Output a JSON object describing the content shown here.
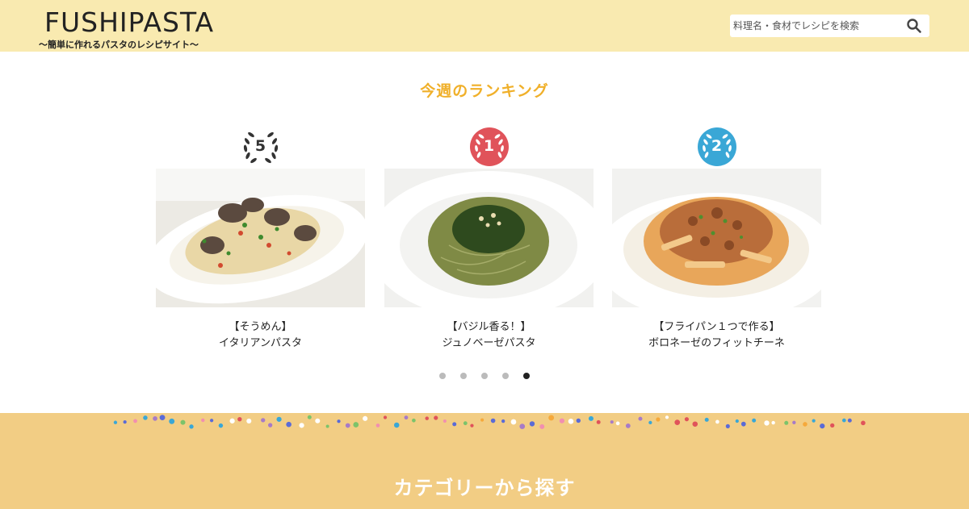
{
  "header": {
    "logo": "FUSHIPASTA",
    "tagline": "〜簡単に作れるパスタのレシピサイト〜",
    "search": {
      "placeholder": "料理名・食材でレシピを検索",
      "value": ""
    }
  },
  "ranking": {
    "title": "今週のランキング",
    "items": [
      {
        "rank": "5",
        "badge_color": "#ffffff",
        "line1": "【そうめん】",
        "line2": "イタリアンパスタ"
      },
      {
        "rank": "1",
        "badge_color": "#e0535a",
        "line1": "【バジル香る！】",
        "line2": "ジュノベーゼパスタ"
      },
      {
        "rank": "2",
        "badge_color": "#3aa7d6",
        "line1": "【フライパン１つで作る】",
        "line2": "ボロネーゼのフィットチーネ"
      }
    ],
    "pagination": {
      "count": 5,
      "active_index": 4
    }
  },
  "category": {
    "title": "カテゴリーから探す",
    "background": "#f2cd84"
  },
  "colors": {
    "header_bg": "#f9eab0",
    "accent": "#f0b02a"
  }
}
